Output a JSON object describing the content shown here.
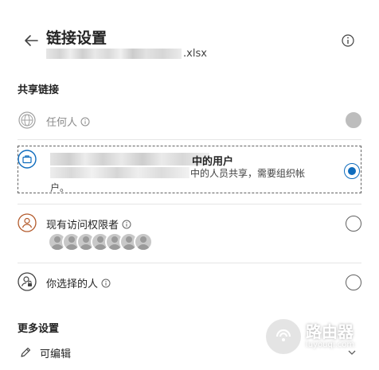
{
  "header": {
    "title": "链接设置",
    "filename_suffix": ".xlsx",
    "back_icon": "arrow-left-icon",
    "info_icon": "info-icon"
  },
  "share_link": {
    "section_label": "共享链接",
    "options": [
      {
        "label": "任何人",
        "icon": "globe-icon",
        "state": "disabled",
        "has_info": true
      },
      {
        "label_suffix": "中的用户",
        "desc_line1": "中的人员共享，需要组织帐",
        "desc_line2": "户。",
        "icon": "briefcase-icon",
        "state": "selected"
      },
      {
        "label": "现有访问权限者",
        "icon": "person-icon",
        "state": "unselected",
        "has_info": true,
        "avatar_count": 7
      },
      {
        "label": "你选择的人",
        "icon": "person-lock-icon",
        "state": "unselected",
        "has_info": true
      }
    ]
  },
  "more_settings": {
    "section_label": "更多设置",
    "permission_label": "可编辑"
  },
  "watermark": {
    "big": "路由器",
    "small": "luyouqi.com"
  },
  "colors": {
    "accent": "#0f6cbd",
    "text": "#242424",
    "divider": "#e6e6e6",
    "disabled": "#bdbdbd"
  }
}
